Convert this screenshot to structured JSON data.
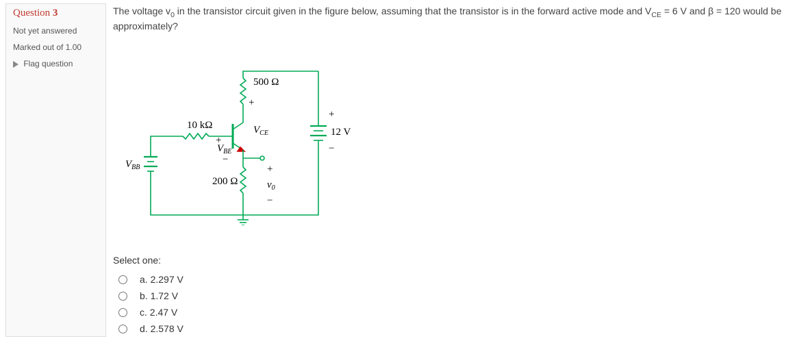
{
  "info": {
    "question_label": "Question",
    "question_number": "3",
    "status": "Not yet answered",
    "mark": "Marked out of 1.00",
    "flag": "Flag question"
  },
  "question": {
    "pre": "The voltage v",
    "sub1": "0",
    "mid": " in the transistor circuit given in the figure below, assuming that the transistor is in the forward active mode and V",
    "sub2": "CE",
    "post": " = 6 V and β = 120 would be approximately?"
  },
  "circuit": {
    "r1": "10 kΩ",
    "r2": "500 Ω",
    "r3": "200 Ω",
    "vbb": "V",
    "vbb_sub": "BB",
    "vce": "V",
    "vce_sub": "CE",
    "vbe": "V",
    "vbe_sub": "BE",
    "vsrc": "12 V",
    "vout": "v",
    "vout_sub": "0",
    "plus": "+",
    "minus": "−"
  },
  "select_label": "Select one:",
  "options": [
    {
      "label": "a. 2.297 V"
    },
    {
      "label": "b. 1.72 V"
    },
    {
      "label": "c. 2.47 V"
    },
    {
      "label": "d. 2.578 V"
    }
  ]
}
